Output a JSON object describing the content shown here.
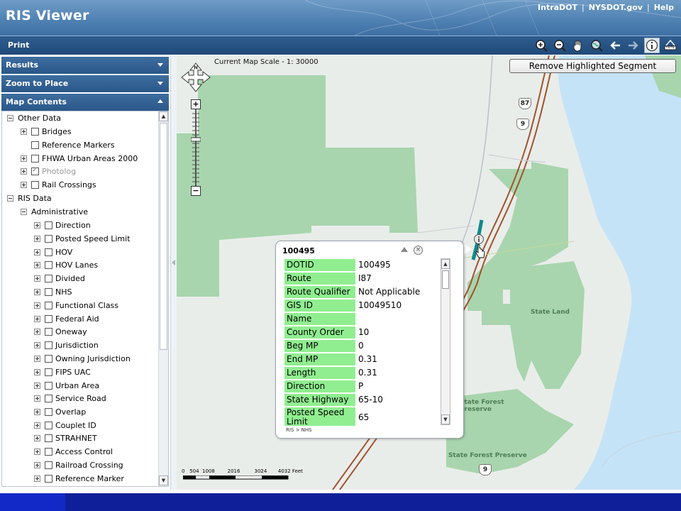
{
  "header": {
    "title": "RIS Viewer",
    "links": [
      "IntraDOT",
      "NYSDOT.gov",
      "Help"
    ],
    "separator": "|"
  },
  "toolbar": {
    "print_label": "Print",
    "tools": [
      "zoom-in-icon",
      "zoom-out-icon",
      "pan-hand-icon",
      "zoom-extent-globe-icon",
      "back-arrow-icon",
      "forward-arrow-icon",
      "identify-info-icon",
      "ruler-measure-icon"
    ]
  },
  "sidebar": {
    "sections": [
      {
        "label": "Results"
      },
      {
        "label": "Zoom to Place"
      },
      {
        "label": "Map Contents"
      }
    ],
    "tree": [
      {
        "label": "Other Data"
      },
      {
        "label": "Bridges"
      },
      {
        "label": "Reference Markers"
      },
      {
        "label": "FHWA Urban Areas 2000"
      },
      {
        "label": "Photolog"
      },
      {
        "label": "Rail Crossings"
      },
      {
        "label": "RIS Data"
      },
      {
        "label": "Administrative"
      },
      {
        "label": "Direction"
      },
      {
        "label": "Posted Speed Limit"
      },
      {
        "label": "HOV"
      },
      {
        "label": "HOV Lanes"
      },
      {
        "label": "Divided"
      },
      {
        "label": "NHS"
      },
      {
        "label": "Functional Class"
      },
      {
        "label": "Federal Aid"
      },
      {
        "label": "Oneway"
      },
      {
        "label": "Jurisdiction"
      },
      {
        "label": "Owning Jurisdiction"
      },
      {
        "label": "FIPS UAC"
      },
      {
        "label": "Urban Area"
      },
      {
        "label": "Service Road"
      },
      {
        "label": "Overlap"
      },
      {
        "label": "Couplet ID"
      },
      {
        "label": "STRAHNET"
      },
      {
        "label": "Access Control"
      },
      {
        "label": "Railroad Crossing"
      },
      {
        "label": "Reference Marker"
      }
    ]
  },
  "map": {
    "scale_text": "Current Map Scale - 1: 30000",
    "remove_button": "Remove Highlighted Segment",
    "compass_label": "N",
    "labels": {
      "state_land": "State Land",
      "state_forest_preserve_1": "State Forest\nPreserve",
      "state_forest_preserve_2": "State Forest Preserve"
    },
    "shields": [
      "87",
      "9",
      "9"
    ],
    "scalebar": {
      "ticks": [
        "0",
        "504",
        "1008",
        "2016",
        "3024",
        "4032 Feet"
      ]
    }
  },
  "popup": {
    "title": "100495",
    "breadcrumb": "RIS > NHS",
    "attributes": [
      {
        "key": "DOTID",
        "value": "100495"
      },
      {
        "key": "Route",
        "value": "I87"
      },
      {
        "key": "Route Qualifier",
        "value": "Not Applicable"
      },
      {
        "key": "GIS ID",
        "value": "10049510"
      },
      {
        "key": "Name",
        "value": ""
      },
      {
        "key": "County Order",
        "value": "10"
      },
      {
        "key": "Beg MP",
        "value": "0"
      },
      {
        "key": "End MP",
        "value": "0.31"
      },
      {
        "key": "Length",
        "value": "0.31"
      },
      {
        "key": "Direction",
        "value": "P"
      },
      {
        "key": "State Highway",
        "value": "65-10"
      },
      {
        "key": "Posted Speed Limit",
        "value": "65"
      }
    ]
  },
  "colors": {
    "header": "#4e80b2",
    "toolbar": "#1f4a79",
    "attribute_key_bg": "#90ee90",
    "water": "#c5e3f7",
    "forest": "#a8d5ad",
    "highlight": "#0e8a8a",
    "footer": "#0f1f9a"
  }
}
